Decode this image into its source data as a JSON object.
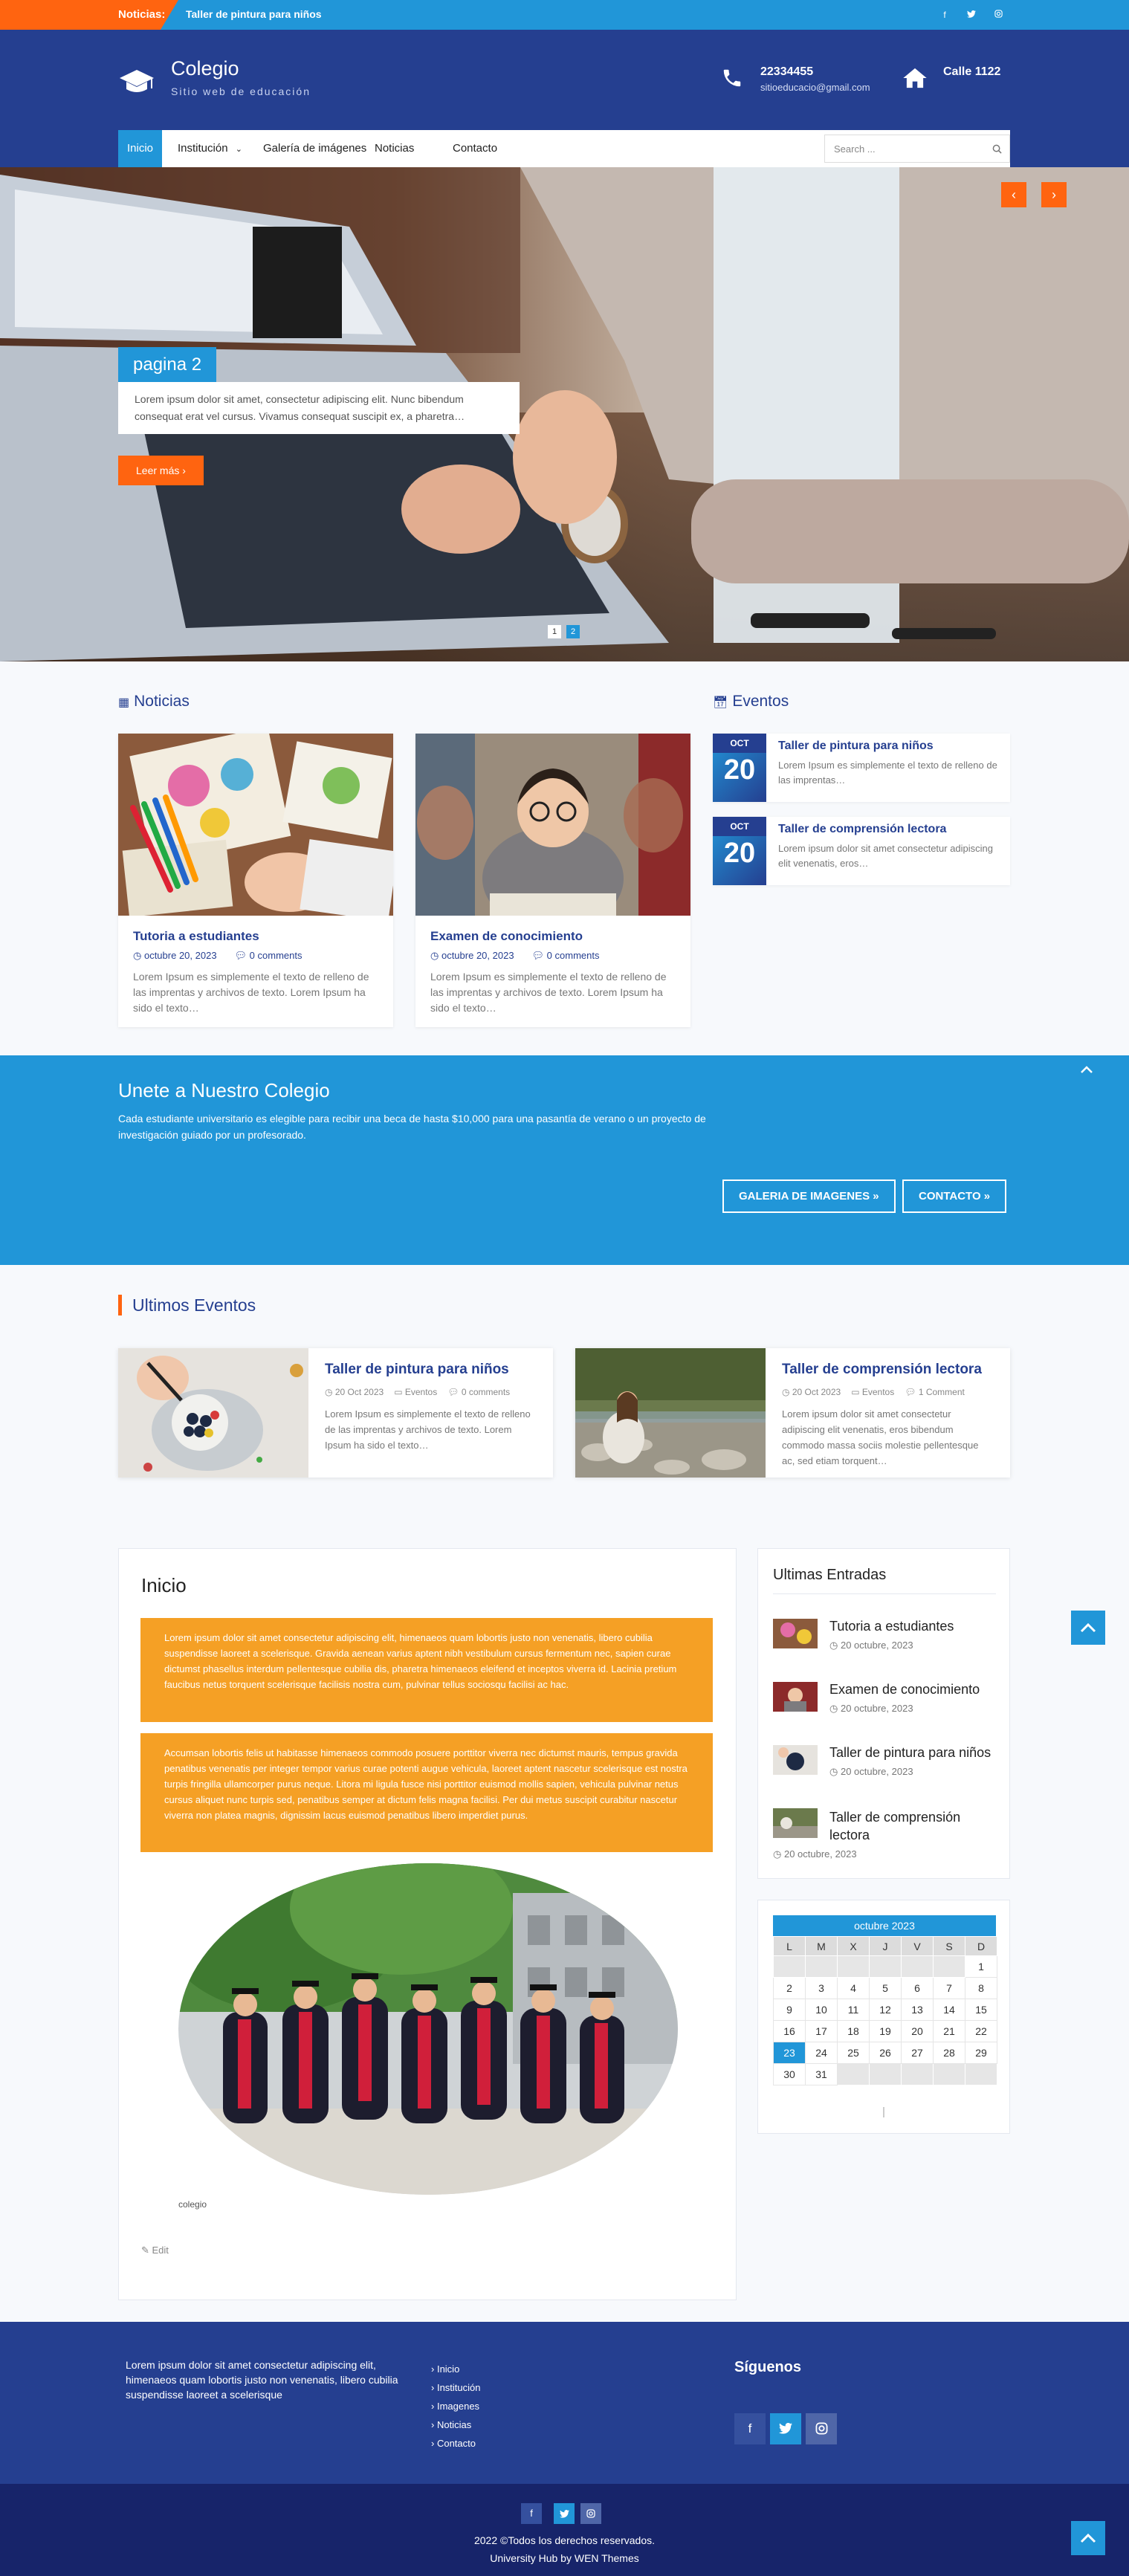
{
  "topbar": {
    "news_label": "Noticias:",
    "ticker": "Taller de pintura para niños",
    "social": [
      "f",
      "t",
      "ig"
    ]
  },
  "header": {
    "title": "Colegio",
    "tagline": "Sitio web de educación",
    "phone": "22334455",
    "email": "sitioeducacio@gmail.com",
    "address": "Calle 1122"
  },
  "nav": {
    "items": [
      "Inicio",
      "Institución",
      "Galería de imágenes",
      "Noticias",
      "Contacto"
    ],
    "search_placeholder": "Search ..."
  },
  "hero": {
    "title": "pagina 2",
    "text": "Lorem ipsum dolor sit amet, consectetur adipiscing elit. Nunc bibendum consequat erat vel cursus. Vivamus consequat suscipit ex, a pharetra…",
    "button": "Leer más",
    "prev": "‹",
    "next": "›",
    "pages": [
      "1",
      "2"
    ]
  },
  "noticias": {
    "heading": "Noticias",
    "posts": [
      {
        "title": "Tutoria a estudiantes",
        "date": "octubre 20, 2023",
        "comments": "0 comments",
        "excerpt": "Lorem Ipsum es simplemente el texto de relleno de las imprentas y archivos de texto. Lorem Ipsum ha sido el texto…"
      },
      {
        "title": "Examen de conocimiento",
        "date": "octubre 20, 2023",
        "comments": "0 comments",
        "excerpt": "Lorem Ipsum es simplemente el texto de relleno de las imprentas y archivos de texto. Lorem Ipsum ha sido el texto…"
      }
    ]
  },
  "eventos": {
    "heading": "Eventos",
    "items": [
      {
        "month": "OCT",
        "day": "20",
        "title": "Taller de pintura para niños",
        "excerpt": "Lorem Ipsum es simplemente el texto de relleno de las imprentas…"
      },
      {
        "month": "OCT",
        "day": "20",
        "title": "Taller de comprensión lectora",
        "excerpt": "Lorem ipsum dolor sit amet consectetur adipiscing elit venenatis, eros…"
      }
    ]
  },
  "join": {
    "title": "Unete a Nuestro Colegio",
    "text": "Cada estudiante universitario es elegible para recibir una beca de hasta $10,000 para una pasantía de verano o un proyecto de investigación guiado por un profesorado.",
    "btn1": "GALERIA DE IMAGENES »",
    "btn2": "CONTACTO »"
  },
  "ultimos_eventos": {
    "heading": "Ultimos Eventos",
    "items": [
      {
        "title": "Taller de pintura para niños",
        "date": "20 Oct 2023",
        "cat": "Eventos",
        "comments": "0 comments",
        "excerpt": "Lorem Ipsum es simplemente el texto de relleno de las imprentas y archivos de texto. Lorem Ipsum ha sido el texto…"
      },
      {
        "title": "Taller de comprensión lectora",
        "date": "20 Oct 2023",
        "cat": "Eventos",
        "comments": "1 Comment",
        "excerpt": "Lorem ipsum dolor sit amet consectetur adipiscing elit venenatis, eros bibendum commodo massa sociis molestie pellentesque ac, sed etiam torquent…"
      }
    ]
  },
  "main": {
    "title": "Inicio",
    "box1": "Lorem ipsum dolor sit amet consectetur adipiscing elit, himenaeos quam lobortis justo non venenatis, libero cubilia suspendisse laoreet a scelerisque. Gravida aenean varius aptent nibh vestibulum cursus fermentum nec, sapien curae dictumst phasellus interdum pellentesque cubilia dis, pharetra himenaeos eleifend et inceptos viverra id. Lacinia pretium faucibus netus torquent scelerisque facilisis nostra cum, pulvinar tellus sociosqu facilisi ac hac.",
    "box2": "Accumsan lobortis felis ut habitasse himenaeos commodo posuere porttitor viverra nec dictumst mauris, tempus gravida penatibus venenatis per integer tempor varius curae potenti augue vehicula, laoreet aptent nascetur scelerisque est nostra turpis fringilla ullamcorper purus neque. Litora mi ligula fusce nisi porttitor euismod mollis sapien, vehicula pulvinar netus cursus aliquet nunc turpis sed, penatibus semper at dictum felis magna facilisi. Per dui metus suscipit curabitur nascetur viverra non platea magnis, dignissim lacus euismod penatibus libero imperdiet purus.",
    "caption": "colegio",
    "edit": "Edit"
  },
  "sidebar": {
    "entries_heading": "Ultimas Entradas",
    "entries": [
      {
        "title": "Tutoria a estudiantes",
        "date": "20 octubre, 2023"
      },
      {
        "title": "Examen de conocimiento",
        "date": "20 octubre, 2023"
      },
      {
        "title": "Taller de pintura para niños",
        "date": "20 octubre, 2023"
      },
      {
        "title": "Taller de comprensión lectora",
        "date": "20 octubre, 2023"
      }
    ],
    "calendar": {
      "title": "octubre 2023",
      "days": [
        "L",
        "M",
        "X",
        "J",
        "V",
        "S",
        "D"
      ],
      "rows": [
        [
          "",
          "",
          "",
          "",
          "",
          "",
          "1"
        ],
        [
          "2",
          "3",
          "4",
          "5",
          "6",
          "7",
          "8"
        ],
        [
          "9",
          "10",
          "11",
          "12",
          "13",
          "14",
          "15"
        ],
        [
          "16",
          "17",
          "18",
          "19",
          "20",
          "21",
          "22"
        ],
        [
          "23",
          "24",
          "25",
          "26",
          "27",
          "28",
          "29"
        ],
        [
          "30",
          "31",
          "",
          "",
          "",
          "",
          ""
        ]
      ],
      "today": "23"
    }
  },
  "footer": {
    "text": "Lorem ipsum dolor sit amet consectetur adipiscing elit, himenaeos quam lobortis justo non venenatis, libero cubilia suspendisse laoreet a scelerisque",
    "links": [
      "Inicio",
      "Institución",
      "Imagenes",
      "Noticias",
      "Contacto"
    ],
    "follow": "Síguenos",
    "copyright": "2022 ©Todos los derechos reservados.",
    "credit": "University Hub by WEN Themes"
  },
  "colors": {
    "primary": "#2196d8",
    "dark": "#253f90",
    "accent": "#ff6410",
    "orange_box": "#f5a025"
  }
}
